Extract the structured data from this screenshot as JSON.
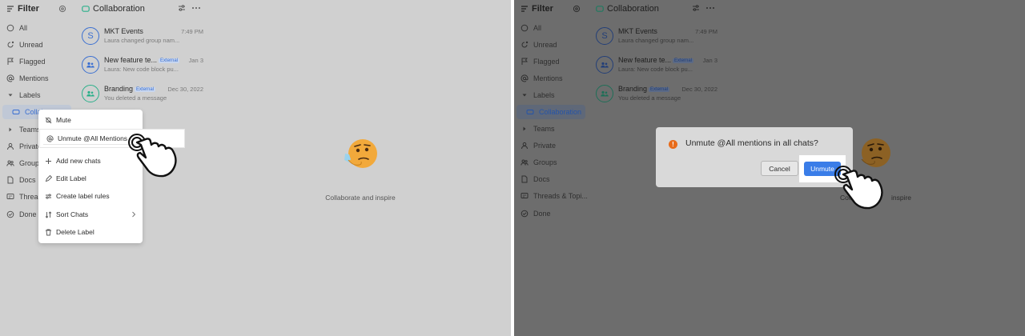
{
  "left": {
    "filter": {
      "title": "Filter",
      "items": [
        {
          "label": "All",
          "icon": "chat-bubble-icon"
        },
        {
          "label": "Unread",
          "icon": "unread-icon"
        },
        {
          "label": "Flagged",
          "icon": "flag-icon"
        },
        {
          "label": "Mentions",
          "icon": "at-icon"
        },
        {
          "label": "Labels",
          "icon": "caret-down-icon"
        },
        {
          "label": "Collabora",
          "icon": "label-icon"
        },
        {
          "label": "Teams",
          "icon": "caret-right-icon"
        },
        {
          "label": "Private",
          "icon": "person-icon"
        },
        {
          "label": "Groups",
          "icon": "group-icon"
        },
        {
          "label": "Docs",
          "icon": "doc-icon"
        },
        {
          "label": "Threac",
          "icon": "thread-icon"
        },
        {
          "label": "Done",
          "icon": "check-circle-icon"
        }
      ]
    },
    "list": {
      "title": "Collaboration",
      "chats": [
        {
          "avatar": "S",
          "name": "MKT Events",
          "badge": "",
          "time": "7:49 PM",
          "preview": "Laura changed group nam..."
        },
        {
          "avatar": "",
          "name": "New feature te...",
          "badge": "External",
          "time": "Jan 3",
          "preview": "Laura: New code block pu..."
        },
        {
          "avatar": "",
          "name": "Branding",
          "badge": "External",
          "time": "Dec 30, 2022",
          "preview": "You deleted a message"
        }
      ]
    },
    "main": {
      "caption": "Collaborate and inspire"
    },
    "context_menu": {
      "items": [
        {
          "label": "Mute",
          "icon": "bell-off-icon"
        },
        {
          "label": "Unmute @All Mentions",
          "icon": "at-icon"
        },
        {
          "label": "Add new chats",
          "icon": "plus-icon"
        },
        {
          "label": "Edit Label",
          "icon": "pencil-icon"
        },
        {
          "label": "Create label rules",
          "icon": "rules-icon"
        },
        {
          "label": "Sort Chats",
          "icon": "sort-icon"
        },
        {
          "label": "Delete Label",
          "icon": "trash-icon"
        }
      ]
    }
  },
  "right": {
    "filter": {
      "title": "Filter",
      "items": [
        {
          "label": "All"
        },
        {
          "label": "Unread"
        },
        {
          "label": "Flagged"
        },
        {
          "label": "Mentions"
        },
        {
          "label": "Labels"
        },
        {
          "label": "Collaboration"
        },
        {
          "label": "Teams"
        },
        {
          "label": "Private"
        },
        {
          "label": "Groups"
        },
        {
          "label": "Docs"
        },
        {
          "label": "Threads & Topi..."
        },
        {
          "label": "Done"
        }
      ]
    },
    "list": {
      "title": "Collaboration",
      "chats": [
        {
          "avatar": "S",
          "name": "MKT Events",
          "badge": "",
          "time": "7:49 PM",
          "preview": "Laura changed group nam..."
        },
        {
          "avatar": "",
          "name": "New feature te...",
          "badge": "External",
          "time": "Jan 3",
          "preview": "Laura: New code block pu..."
        },
        {
          "avatar": "",
          "name": "Branding",
          "badge": "External",
          "time": "Dec 30, 2022",
          "preview": "You deleted a message"
        }
      ]
    },
    "main": {
      "caption_left": "Colla",
      "caption_right": "inspire"
    },
    "dialog": {
      "icon": "!",
      "message": "Unmute @All mentions in all chats?",
      "cancel_label": "Cancel",
      "confirm_label": "Unmute"
    }
  },
  "colors": {
    "accent": "#3a7de8",
    "warning": "#e86b1a",
    "left_bg": "#d0d0d0",
    "right_bg": "#6d6d6d"
  }
}
